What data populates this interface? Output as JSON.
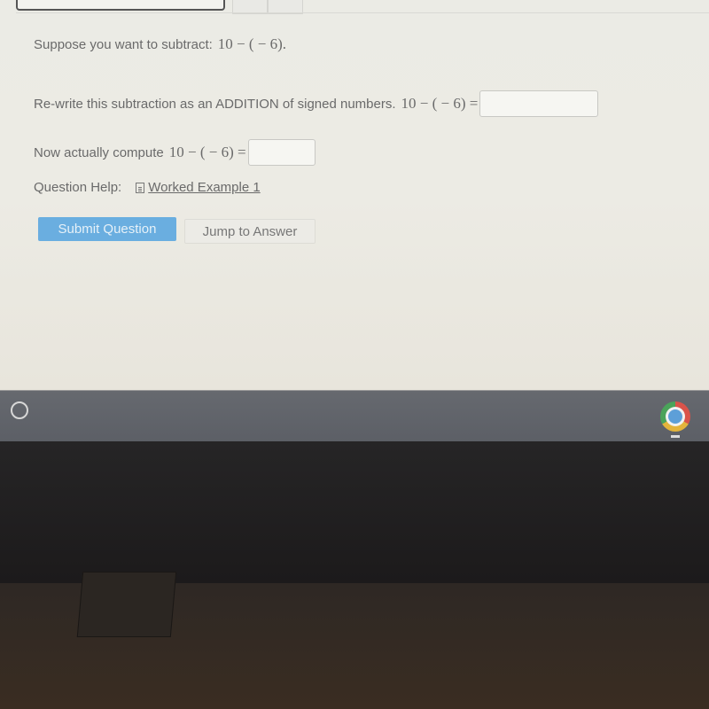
{
  "question": {
    "intro_text": "Suppose you want to subtract:",
    "intro_math": "10 − ( − 6).",
    "part1_text": "Re-write this subtraction as an ADDITION of signed numbers.",
    "part1_math": "10 − ( − 6) =",
    "part1_value": "",
    "part2_text": "Now actually compute",
    "part2_math": "10 − ( − 6) =",
    "part2_value": ""
  },
  "help": {
    "label": "Question Help:",
    "link_label": "Worked Example 1"
  },
  "buttons": {
    "submit": "Submit Question",
    "jump": "Jump to Answer"
  },
  "taskbar": {
    "launcher_icon": "launcher-circle",
    "pinned_app_icon": "chrome-icon"
  }
}
